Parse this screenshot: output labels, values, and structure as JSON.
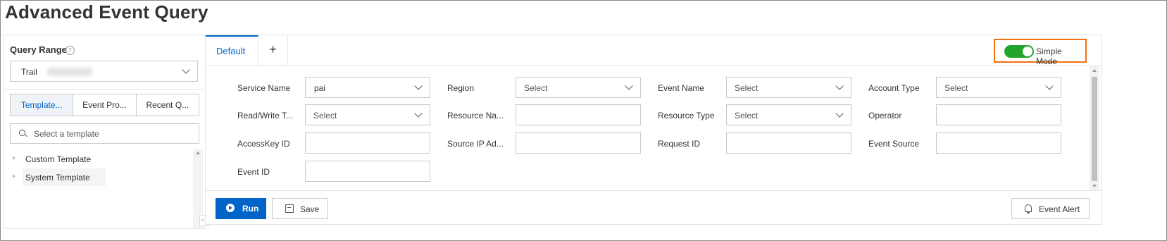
{
  "page": {
    "title": "Advanced Event Query"
  },
  "left_panel": {
    "query_range_label": "Query Range",
    "help_icon": "question-circle-icon",
    "trail_select": {
      "label": "Trail",
      "icon": "chevron-down-icon"
    },
    "segments": [
      {
        "label": "Template...",
        "active": true
      },
      {
        "label": "Event Pro...",
        "active": false
      },
      {
        "label": "Recent Q...",
        "active": false
      }
    ],
    "template_search": {
      "placeholder": "Select a template",
      "icon": "search-icon"
    },
    "tree": [
      {
        "label": "Custom Template"
      },
      {
        "label": "System Template"
      }
    ]
  },
  "right_panel": {
    "tabs": [
      {
        "label": "Default",
        "active": true
      }
    ],
    "add_tab_label": "+",
    "simple_mode": {
      "label": "Simple Mode",
      "on": true,
      "highlight_color": "#f07111",
      "toggle_color": "#25a42d"
    },
    "fields": [
      {
        "label": "Service Name",
        "value": "pai",
        "type": "select"
      },
      {
        "label": "Region",
        "placeholder": "Select",
        "type": "select"
      },
      {
        "label": "Event Name",
        "placeholder": "Select",
        "type": "select"
      },
      {
        "label": "Account Type",
        "placeholder": "Select",
        "type": "select"
      },
      {
        "label": "Read/Write T...",
        "placeholder": "Select",
        "type": "select"
      },
      {
        "label": "Resource Na...",
        "value": "",
        "type": "input"
      },
      {
        "label": "Resource Type",
        "placeholder": "Select",
        "type": "select"
      },
      {
        "label": "Operator",
        "value": "",
        "type": "input"
      },
      {
        "label": "AccessKey ID",
        "value": "",
        "type": "input"
      },
      {
        "label": "Source IP Ad...",
        "value": "",
        "type": "input"
      },
      {
        "label": "Request ID",
        "value": "",
        "type": "input"
      },
      {
        "label": "Event Source",
        "value": "",
        "type": "input"
      },
      {
        "label": "Event ID",
        "value": "",
        "type": "input"
      }
    ],
    "actions": {
      "run_label": "Run",
      "save_label": "Save",
      "alert_label": "Event Alert"
    }
  },
  "colors": {
    "primary": "#0064c8",
    "active_segment_bg": "#eff3f8"
  }
}
